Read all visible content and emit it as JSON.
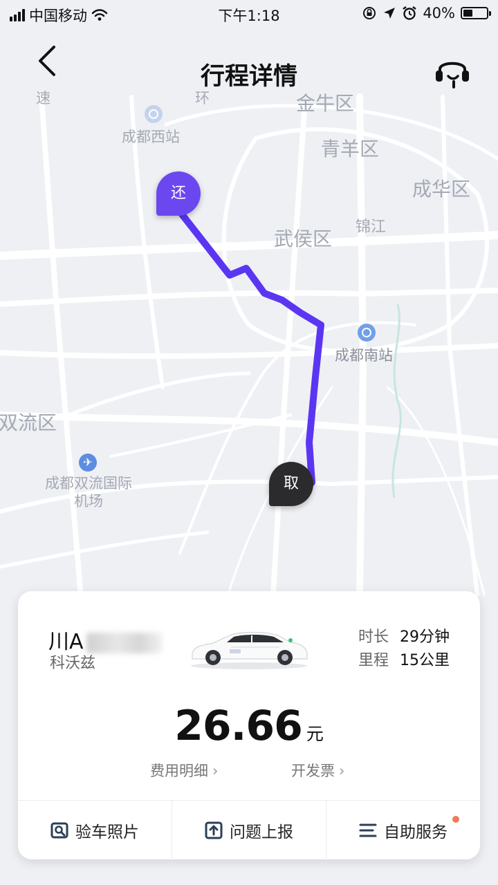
{
  "status_bar": {
    "carrier": "中国移动",
    "time": "下午1:18",
    "battery": "40%",
    "battery_level": 0.4
  },
  "nav": {
    "title": "行程详情"
  },
  "map": {
    "labels": {
      "jinniu": "金牛区",
      "qingyang": "青羊区",
      "chenghua": "成华区",
      "wuhou": "武侯区",
      "jinjiang": "锦江",
      "shuangliu": "双流区",
      "chengdu_west": "成都西站",
      "chengdu_south": "成都南站",
      "airport": "成都双流国际机场",
      "ring": "环",
      "su": "速"
    },
    "pins": {
      "return": "还",
      "pickup": "取"
    }
  },
  "trip": {
    "plate_prefix": "川A",
    "car_model": "科沃兹",
    "duration_label": "时长",
    "duration_value": "29分钟",
    "distance_label": "里程",
    "distance_value": "15公里",
    "price": "26.66",
    "currency": "元",
    "fee_detail": "费用明细",
    "invoice": "开发票"
  },
  "actions": [
    {
      "label": "验车照片",
      "icon": "photo-search-icon"
    },
    {
      "label": "问题上报",
      "icon": "upload-icon"
    },
    {
      "label": "自助服务",
      "icon": "menu-icon"
    }
  ],
  "colors": {
    "route": "#5b36f2",
    "return_pin": "#6b47f0",
    "pickup_pin": "#2b2b2d",
    "badge_dot": "#f07a5a"
  }
}
